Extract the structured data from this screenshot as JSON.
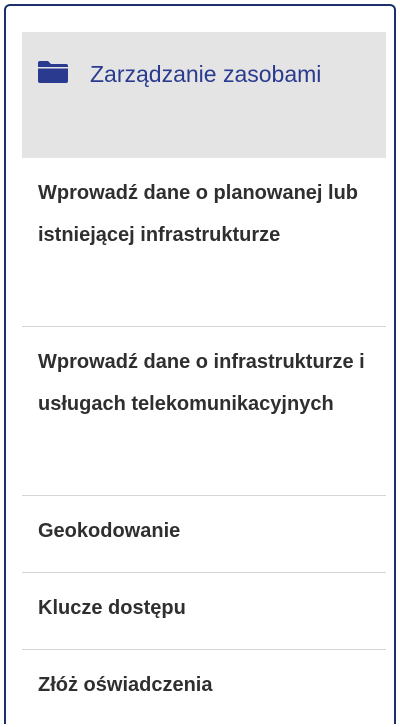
{
  "sidebar": {
    "header": {
      "icon": "folder-icon",
      "label": "Zarządzanie zasobami",
      "color": "#2a3b8f",
      "background": "#e4e4e4"
    },
    "items": [
      {
        "label": "Wprowadź dane o planowanej lub istniejącej infrastrukturze"
      },
      {
        "label": "Wprowadź dane o infrastrukturze i usługach telekomunikacyjnych"
      },
      {
        "label": "Geokodowanie"
      },
      {
        "label": "Klucze dostępu"
      },
      {
        "label": "Złóż oświadczenia"
      }
    ]
  },
  "colors": {
    "frame_border": "#1c2f6e",
    "item_text": "#2f2f2f",
    "divider": "#d6d6d6"
  }
}
